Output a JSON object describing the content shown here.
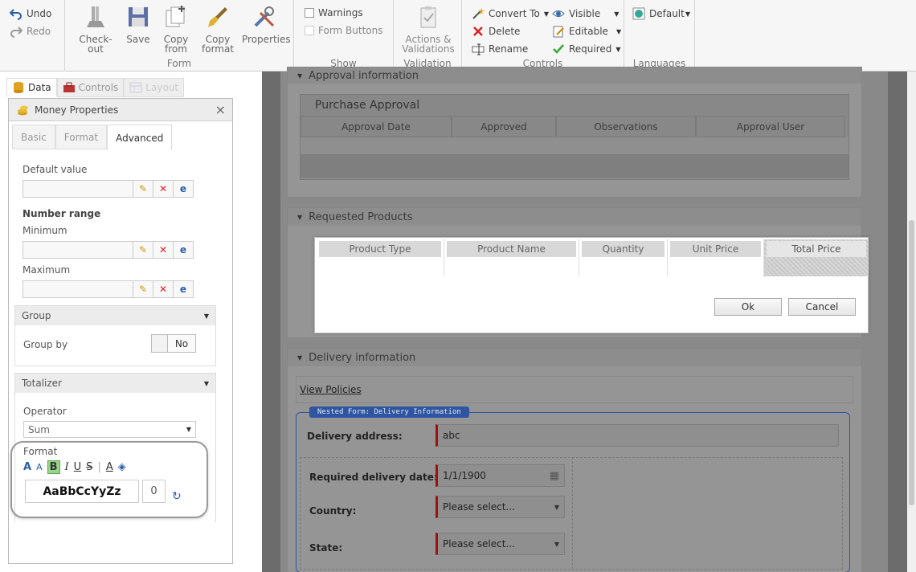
{
  "ribbon": {
    "undo": "Undo",
    "redo": "Redo",
    "form": {
      "checkout": "Check-out",
      "save": "Save",
      "copy_from": "Copy from",
      "copy_format": "Copy format",
      "properties": "Properties",
      "label": "Form"
    },
    "show": {
      "warnings": "Warnings",
      "form_buttons": "Form Buttons",
      "label": "Show"
    },
    "validation": {
      "actions": "Actions & Validations",
      "label": "Validation"
    },
    "controls": {
      "convert_to": "Convert To",
      "delete": "Delete",
      "rename": "Rename",
      "visible": "Visible",
      "editable": "Editable",
      "required": "Required",
      "label": "Controls"
    },
    "languages": {
      "default": "Default",
      "label": "Languages"
    }
  },
  "left": {
    "tabs": {
      "data": "Data",
      "controls": "Controls",
      "layout": "Layout"
    },
    "panel_title": "Money Properties",
    "subtabs": {
      "basic": "Basic",
      "format": "Format",
      "advanced": "Advanced"
    },
    "default_value": "Default value",
    "number_range": "Number range",
    "minimum": "Minimum",
    "maximum": "Maximum",
    "group": {
      "title": "Group",
      "group_by": "Group by",
      "toggle": "No"
    },
    "totalizer": {
      "title": "Totalizer",
      "operator": "Operator",
      "operator_value": "Sum",
      "format": "Format",
      "preview": "AaBbCcYyZz",
      "decimals": "0"
    }
  },
  "form": {
    "approval_info": "Approval information",
    "purchase_approval": "Purchase Approval",
    "approval_cols": [
      "Approval Date",
      "Approved",
      "Observations",
      "Approval User"
    ],
    "requested_products": "Requested Products",
    "product_cols": [
      "Product Type",
      "Product Name",
      "Quantity",
      "Unit Price",
      "Total Price"
    ],
    "ok": "Ok",
    "cancel": "Cancel",
    "delivery_info": "Delivery information",
    "view_policies": "View Policies",
    "nested_form": "Nested Form: Delivery Information",
    "delivery_address": "Delivery address:",
    "delivery_address_value": "abc",
    "required_date": "Required delivery date:",
    "required_date_value": "1/1/1900",
    "country": "Country:",
    "country_value": "Please select...",
    "state": "State:",
    "state_value": "Please select..."
  }
}
